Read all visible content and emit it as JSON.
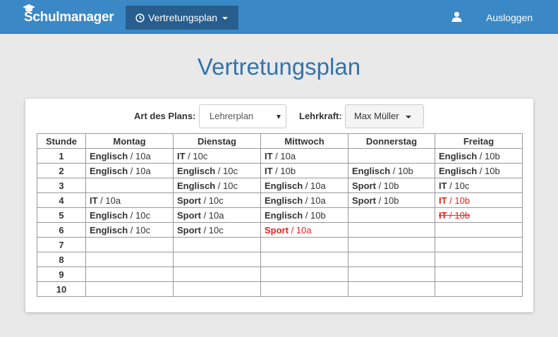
{
  "navbar": {
    "brand": "Schulmanager",
    "dropdown_label": "Vertretungsplan",
    "logout_label": "Ausloggen",
    "bg_color": "#3a88c6"
  },
  "page": {
    "title": "Vertretungsplan"
  },
  "filters": {
    "art_label": "Art des Plans:",
    "art_value": "Lehrerplan",
    "teacher_label": "Lehrkraft:",
    "teacher_value": "Max Müller"
  },
  "table": {
    "headers": [
      "Stunde",
      "Montag",
      "Dienstag",
      "Mittwoch",
      "Donnerstag",
      "Freitag"
    ],
    "rows": [
      {
        "hour": "1",
        "cells": [
          {
            "subject": "Englisch",
            "class": "10a",
            "status": "normal"
          },
          {
            "subject": "IT",
            "class": "10c",
            "status": "normal"
          },
          {
            "subject": "IT",
            "class": "10a",
            "status": "normal"
          },
          null,
          {
            "subject": "Englisch",
            "class": "10b",
            "status": "normal"
          }
        ]
      },
      {
        "hour": "2",
        "cells": [
          {
            "subject": "Englisch",
            "class": "10a",
            "status": "normal"
          },
          {
            "subject": "Englisch",
            "class": "10c",
            "status": "normal"
          },
          {
            "subject": "IT",
            "class": "10b",
            "status": "normal"
          },
          {
            "subject": "Englisch",
            "class": "10b",
            "status": "normal"
          },
          {
            "subject": "Englisch",
            "class": "10b",
            "status": "normal"
          }
        ]
      },
      {
        "hour": "3",
        "cells": [
          null,
          {
            "subject": "Englisch",
            "class": "10c",
            "status": "normal"
          },
          {
            "subject": "Englisch",
            "class": "10a",
            "status": "normal"
          },
          {
            "subject": "Sport",
            "class": "10b",
            "status": "normal"
          },
          {
            "subject": "IT",
            "class": "10c",
            "status": "normal"
          }
        ]
      },
      {
        "hour": "4",
        "cells": [
          {
            "subject": "IT",
            "class": "10a",
            "status": "normal"
          },
          {
            "subject": "Sport",
            "class": "10c",
            "status": "normal"
          },
          {
            "subject": "Englisch",
            "class": "10a",
            "status": "normal"
          },
          {
            "subject": "Sport",
            "class": "10b",
            "status": "normal"
          },
          {
            "subject": "IT",
            "class": "10b",
            "status": "substitution"
          }
        ]
      },
      {
        "hour": "5",
        "cells": [
          {
            "subject": "Englisch",
            "class": "10c",
            "status": "normal"
          },
          {
            "subject": "Sport",
            "class": "10a",
            "status": "normal"
          },
          {
            "subject": "Englisch",
            "class": "10b",
            "status": "normal"
          },
          null,
          {
            "subject": "IT",
            "class": "10b",
            "status": "cancelled"
          }
        ]
      },
      {
        "hour": "6",
        "cells": [
          {
            "subject": "Englisch",
            "class": "10c",
            "status": "normal"
          },
          {
            "subject": "Sport",
            "class": "10c",
            "status": "normal"
          },
          {
            "subject": "Sport",
            "class": "10a",
            "status": "substitution"
          },
          null,
          null
        ]
      },
      {
        "hour": "7",
        "cells": [
          null,
          null,
          null,
          null,
          null
        ]
      },
      {
        "hour": "8",
        "cells": [
          null,
          null,
          null,
          null,
          null
        ]
      },
      {
        "hour": "9",
        "cells": [
          null,
          null,
          null,
          null,
          null
        ]
      },
      {
        "hour": "10",
        "cells": [
          null,
          null,
          null,
          null,
          null
        ]
      }
    ],
    "status_colors": {
      "substitution": "#e8221d",
      "cancelled": "#e8221d"
    }
  }
}
